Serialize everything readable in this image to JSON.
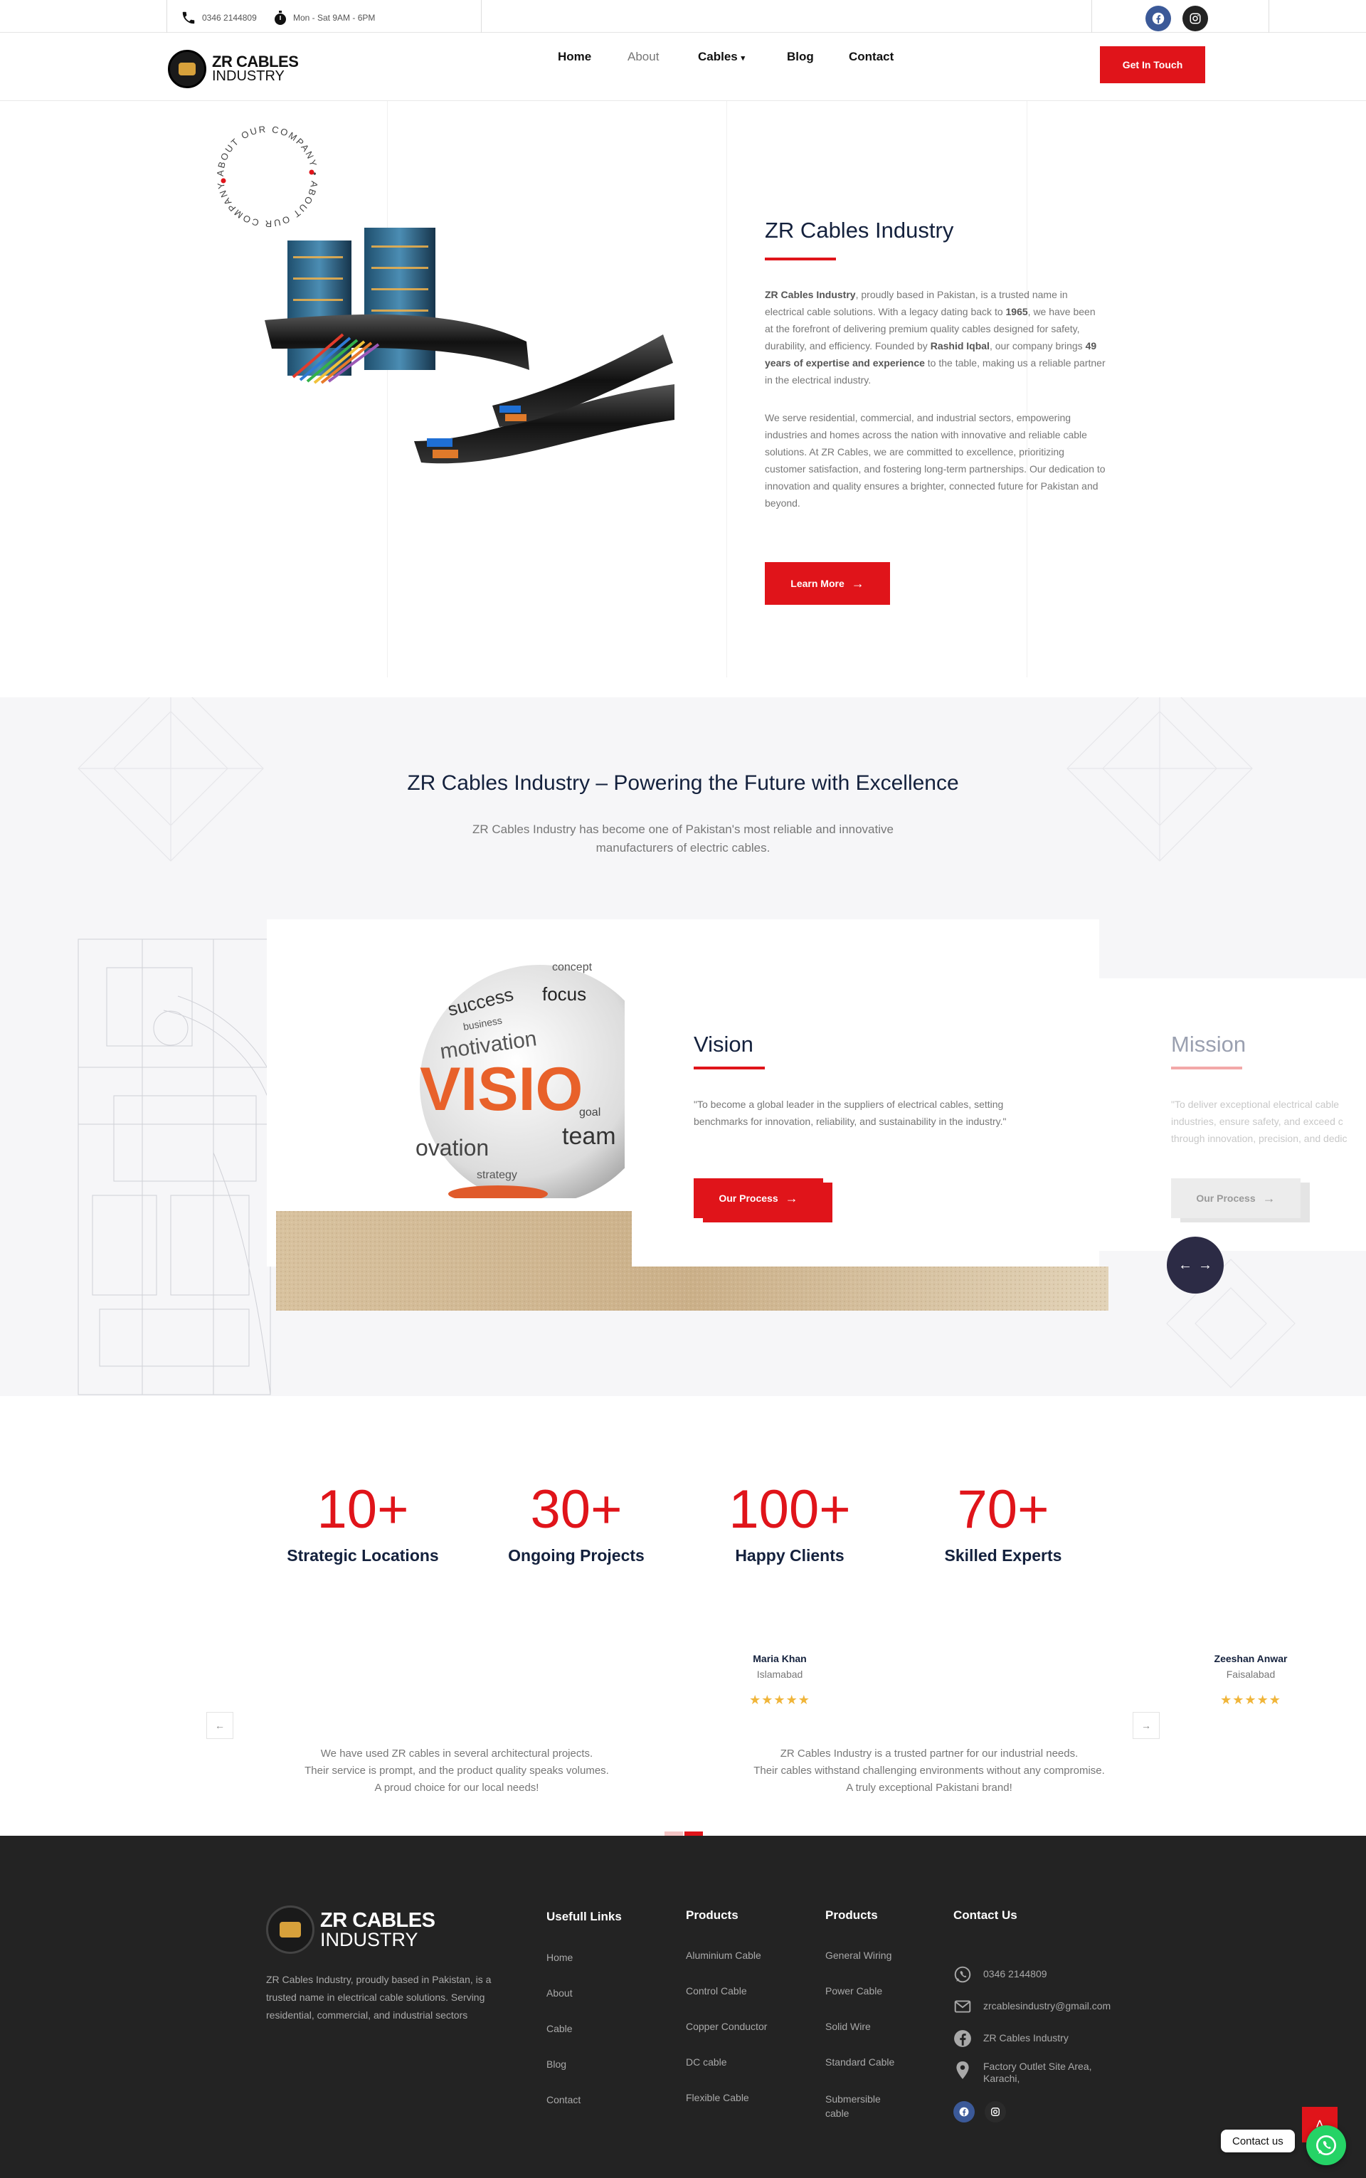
{
  "topbar": {
    "phone": "0346 2144809",
    "hours": "Mon - Sat 9AM - 6PM"
  },
  "header": {
    "logo_line1": "ZR CABLES",
    "logo_line2": "INDUSTRY",
    "nav": [
      "Home",
      "About",
      "Cables",
      "Blog",
      "Contact"
    ],
    "cta": "Get In Touch"
  },
  "about": {
    "badge_text": "ABOUT OUR COMPANY • ABOUT OUR COMPANY •",
    "title": "ZR Cables Industry",
    "p1_company": "ZR Cables Industry",
    "p1_a": ", proudly based in Pakistan, is a trusted name in electrical cable solutions. With a legacy dating back to ",
    "p1_year": "1965",
    "p1_b": ", we have been at the forefront of delivering premium quality cables designed for safety, durability, and efficiency. Founded by ",
    "p1_founder": "Rashid Iqbal",
    "p1_c": ", our company brings ",
    "p1_exp": "49 years of expertise and experience",
    "p1_d": " to the table, making us a reliable partner in the electrical industry.",
    "p2": "We serve residential, commercial, and industrial sectors, empowering industries and homes across the nation with innovative and reliable cable solutions. At ZR Cables, we are committed to excellence, prioritizing customer satisfaction, and fostering long-term partnerships. Our dedication to innovation and quality ensures a brighter, connected future for Pakistan and beyond.",
    "button": "Learn More"
  },
  "excellence": {
    "title": "ZR Cables Industry – Powering the Future with Excellence",
    "subtitle_1": "ZR Cables Industry has become one of Pakistan's most reliable and innovative",
    "subtitle_2": "manufacturers of electric cables."
  },
  "slides": {
    "vision": {
      "title": "Vision",
      "text": "\"To become a global leader in the suppliers of electrical cables, setting benchmarks for innovation, reliability, and sustainability in the industry.\"",
      "button": "Our Process"
    },
    "mission": {
      "title": "Mission",
      "text": "\"To deliver exceptional electrical cables ... industries, ensure safety, and exceed c... through innovation, precision, and dedic...",
      "text_1": "\"To deliver exceptional electrical cable",
      "text_2": "industries, ensure safety, and exceed c",
      "text_3": "through innovation, precision, and dedic",
      "button": "Our Process"
    },
    "vision_image_words": [
      "VISIO",
      "success",
      "focus",
      "business",
      "motivation",
      "goal",
      "team",
      "strategy",
      "concept",
      "ovation"
    ]
  },
  "stats": [
    {
      "value": "10+",
      "label": "Strategic Locations"
    },
    {
      "value": "30+",
      "label": "Ongoing Projects"
    },
    {
      "value": "100+",
      "label": "Happy Clients"
    },
    {
      "value": "70+",
      "label": "Skilled Experts"
    }
  ],
  "testimonials": [
    {
      "text_1": "We have used ZR cables in several architectural projects.",
      "text_2": "Their service is prompt, and the product quality speaks volumes.",
      "text_3": "A proud choice for our local needs!"
    },
    {
      "name": "Maria Khan",
      "city": "Islamabad",
      "stars": "★★★★★",
      "text_1": "ZR Cables Industry is a trusted partner for our industrial needs.",
      "text_2": "Their cables withstand challenging environments without any compromise.",
      "text_3": "A truly exceptional Pakistani brand!"
    },
    {
      "name": "Zeeshan Anwar",
      "city": "Faisalabad",
      "stars": "★★★★★"
    }
  ],
  "footer": {
    "logo_line1": "ZR CABLES",
    "logo_line2": "INDUSTRY",
    "about_1": "ZR Cables Industry, proudly based in Pakistan, is a",
    "about_2": "trusted name in electrical cable solutions. Serving",
    "about_3": "residential, commercial, and industrial sectors",
    "useful_heading": "Usefull Links",
    "useful_links": [
      "Home",
      "About",
      "Cable",
      "Blog",
      "Contact"
    ],
    "products1_heading": "Products",
    "products1": [
      "Aluminium Cable",
      "Control Cable",
      "Copper Conductor",
      "DC cable",
      "Flexible Cable"
    ],
    "products2_heading": "Products",
    "products2": [
      "General Wiring",
      "Power Cable",
      "Solid Wire",
      "Standard Cable",
      "Submersible cable"
    ],
    "contact_heading": "Contact Us",
    "phone": "0346 2144809",
    "email": "zrcablesindustry@gmail.com",
    "facebook": "ZR Cables Industry",
    "address_1": "Factory Outlet Site Area,",
    "address_2": "Karachi,",
    "contact_us_bubble": "Contact us"
  },
  "colors": {
    "accent_red": "#e0141a",
    "navy": "#14213d",
    "footer_bg": "#232323",
    "star": "#f0b53a",
    "facebook_blue": "#3b5998",
    "whatsapp_green": "#25d366"
  }
}
